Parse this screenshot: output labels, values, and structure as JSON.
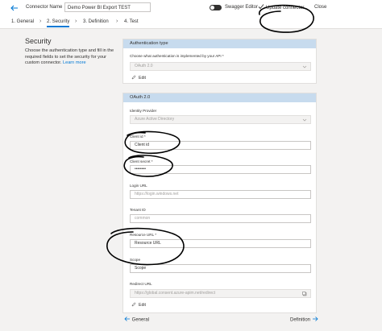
{
  "header": {
    "connector_name_label": "Connector Name",
    "connector_name_value": "Demo Power BI Export TEST",
    "swagger_label": "Swagger Editor",
    "update_label": "Update connector",
    "close_label": "Close"
  },
  "tabs": [
    {
      "label": "1. General"
    },
    {
      "label": "2. Security"
    },
    {
      "label": "3. Definition"
    },
    {
      "label": "4. Test"
    }
  ],
  "sidebar": {
    "title": "Security",
    "description": "Choose the authentication type and fill in the required fields to set the security for your custom connector.",
    "learn_more": "Learn more"
  },
  "auth_type": {
    "header": "Authentication type",
    "label": "Choose what authentication is implemented by your API *",
    "value": "OAuth 2.0",
    "edit": "Edit"
  },
  "oauth": {
    "header": "OAuth 2.0",
    "identity_provider_label": "Identity Provider",
    "identity_provider_value": "Azure Active Directory",
    "client_id_label": "Client id *",
    "client_id_value": "Client id",
    "client_secret_label": "Client secret *",
    "client_secret_value": "••••••••",
    "login_url_label": "Login URL",
    "login_url_value": "https://login.windows.net",
    "tenant_id_label": "Tenant ID",
    "tenant_id_value": "common",
    "resource_url_label": "Resource URL *",
    "resource_url_value": "Resource URL",
    "scope_label": "Scope",
    "scope_value": "Scope",
    "redirect_url_label": "Redirect URL",
    "redirect_url_value": "https://global.consent.azure-apim.net/redirect",
    "edit": "Edit"
  },
  "footer": {
    "back_label": "General",
    "next_label": "Definition"
  },
  "colors": {
    "accent": "#0078d4",
    "card_header": "#c7dbee",
    "background": "#f3f2f1"
  },
  "icons": [
    "back-arrow-icon",
    "toggle-switch",
    "checkmark-icon",
    "chevron-down-icon",
    "pencil-icon",
    "arrow-left-icon",
    "arrow-right-icon"
  ]
}
